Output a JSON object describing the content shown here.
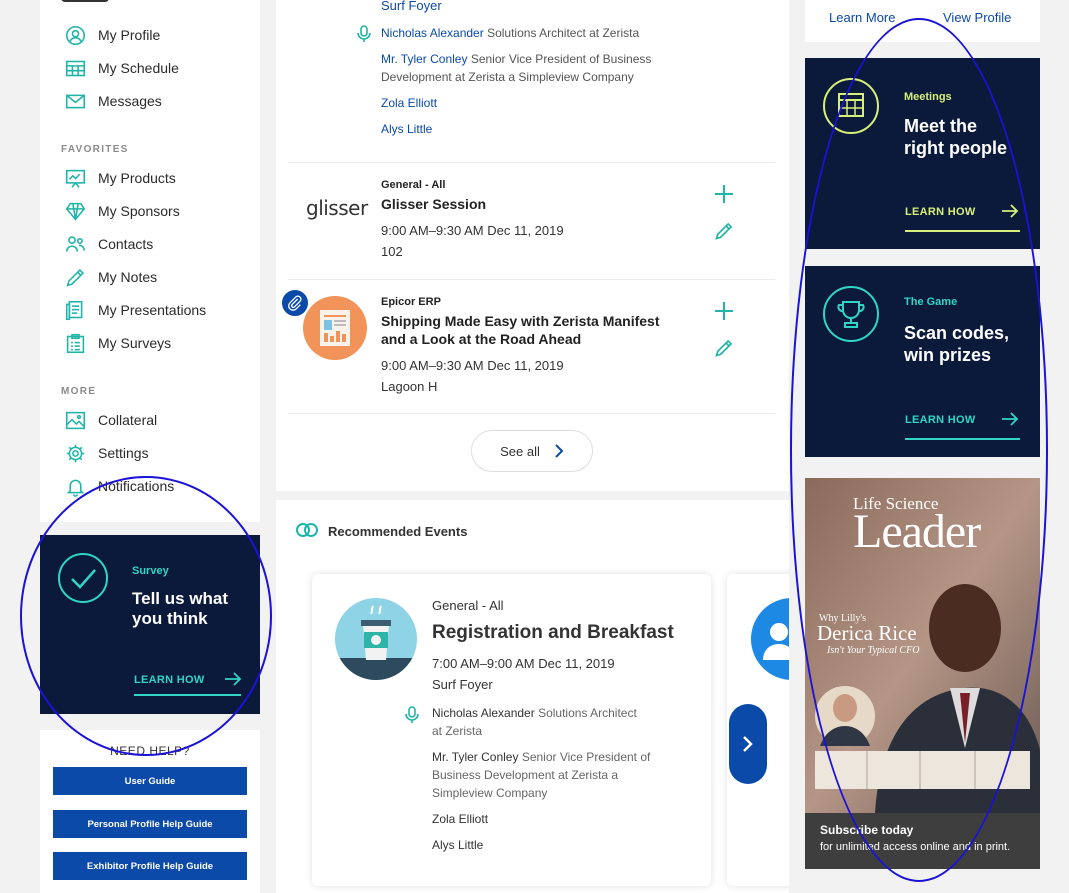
{
  "sidebar": {
    "items": [
      {
        "label": "My Profile",
        "icon": "user-circle-icon"
      },
      {
        "label": "My Schedule",
        "icon": "calendar-grid-icon"
      },
      {
        "label": "Messages",
        "icon": "envelope-icon"
      }
    ],
    "favorites_heading": "FAVORITES",
    "favorites": [
      {
        "label": "My Products",
        "icon": "presentation-board-icon"
      },
      {
        "label": "My Sponsors",
        "icon": "diamond-icon"
      },
      {
        "label": "Contacts",
        "icon": "people-icon"
      },
      {
        "label": "My Notes",
        "icon": "pencil-icon"
      },
      {
        "label": "My Presentations",
        "icon": "documents-icon"
      },
      {
        "label": "My Surveys",
        "icon": "clipboard-list-icon"
      }
    ],
    "more_heading": "MORE",
    "more": [
      {
        "label": "Collateral",
        "icon": "image-icon"
      },
      {
        "label": "Settings",
        "icon": "gear-icon"
      },
      {
        "label": "Notifications",
        "icon": "bell-icon"
      }
    ]
  },
  "survey_ad": {
    "kicker": "Survey",
    "title_line1": "Tell us what",
    "title_line2": "you think",
    "cta": "LEARN HOW"
  },
  "help": {
    "title": "NEED HELP?",
    "buttons": [
      "User Guide",
      "Personal Profile Help Guide",
      "Exhibitor Profile Help Guide"
    ]
  },
  "sessions": {
    "top_location": "Surf Foyer",
    "top_speakers": [
      {
        "name": "Nicholas Alexander",
        "role": "Solutions Architect at Zerista"
      },
      {
        "name": "Mr. Tyler Conley",
        "role": "Senior Vice President of Business",
        "role2": "Development at Zerista a Simpleview Company"
      },
      {
        "name": "Zola Elliott",
        "role": ""
      },
      {
        "name": "Alys Little",
        "role": ""
      }
    ],
    "session2": {
      "logo_text": "glisser",
      "track": "General - All",
      "title": "Glisser Session",
      "time": "9:00 AM–9:30 AM Dec 11, 2019",
      "location": "102"
    },
    "session3": {
      "track": "Epicor ERP",
      "title_line1": "Shipping Made Easy with Zerista Manifest",
      "title_line2": "and a Look at the Road Ahead",
      "time": "9:00 AM–9:30 AM Dec 11, 2019",
      "location": "Lagoon H"
    },
    "see_all": "See all"
  },
  "recommended": {
    "heading": "Recommended Events",
    "event": {
      "track": "General - All",
      "title": "Registration and Breakfast",
      "time": "7:00 AM–9:00 AM Dec 11, 2019",
      "location": "Surf Foyer",
      "speakers": [
        {
          "name": "Nicholas Alexander",
          "role": "Solutions Architect",
          "role2": "at Zerista"
        },
        {
          "name": "Mr. Tyler Conley",
          "role": "Senior Vice President of",
          "role2": "Business Development at Zerista a",
          "role3": "Simpleview Company"
        },
        {
          "name": "Zola Elliott"
        },
        {
          "name": "Alys Little"
        }
      ]
    }
  },
  "right": {
    "learn_more": "Learn More",
    "view_profile": "View Profile",
    "ad_meetings": {
      "kicker": "Meetings",
      "title_line1": "Meet the",
      "title_line2": "right people",
      "cta": "LEARN HOW"
    },
    "ad_game": {
      "kicker": "The Game",
      "title_line1": "Scan codes,",
      "title_line2": "win prizes",
      "cta": "LEARN HOW"
    },
    "magazine": {
      "masthead_small": "Life Science",
      "masthead_big": "Leader",
      "cover_kicker": "Why Lilly's",
      "cover_name": "Derica Rice",
      "cover_sub": "Isn't Your Typical CFO",
      "subscribe": "Subscribe today",
      "subscribe_sub": "for unlimited access online and in print."
    }
  },
  "colors": {
    "accent": "#2fd6c5",
    "brand_blue": "#0b4aa8",
    "ad_navy": "#0b1a3a",
    "annotation": "#1a12d6"
  }
}
